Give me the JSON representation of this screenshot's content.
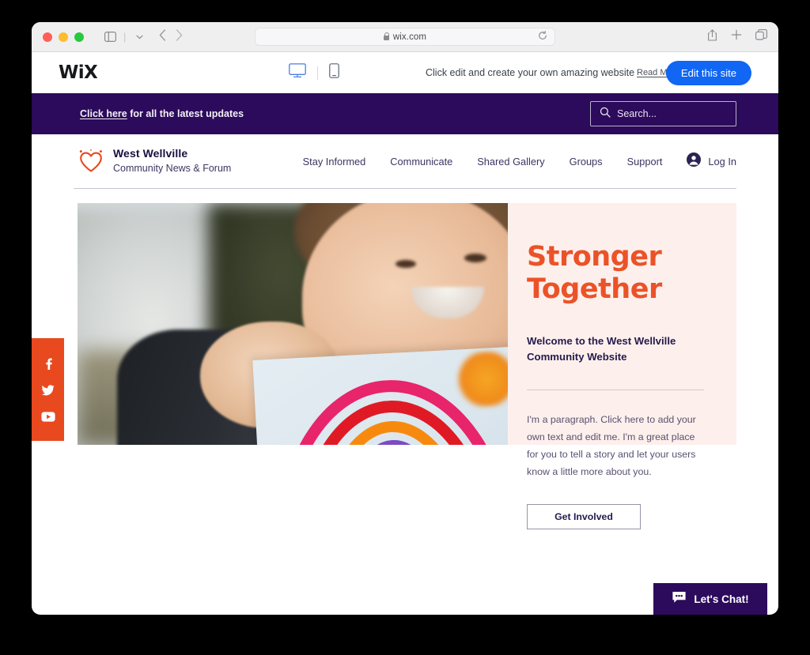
{
  "browser": {
    "traffic_lights": [
      "close",
      "minimize",
      "maximize"
    ],
    "sidebar_toggle_icon": "sidebar-icon",
    "sidebar_dropdown_icon": "chevron-down-icon",
    "back_icon": "chevron-left-icon",
    "forward_icon": "chevron-right-icon",
    "url": "wix.com",
    "lock_icon": "lock-icon",
    "reload_icon": "reload-icon",
    "share_icon": "share-icon",
    "new_tab_icon": "plus-icon",
    "tabs_icon": "tabs-overview-icon"
  },
  "wix_bar": {
    "logo": "WiX",
    "desktop_view_icon": "desktop-monitor-icon",
    "mobile_view_icon": "mobile-phone-icon",
    "message": "Click edit and create your own amazing website",
    "read_more_label": "Read More",
    "edit_button_label": "Edit this site",
    "edit_button_color": "#1166f3"
  },
  "announcement": {
    "link_text": "Click here",
    "rest_text": " for all the latest updates",
    "background_color": "#2c0a5c",
    "search": {
      "placeholder": "Search...",
      "icon": "search-icon"
    }
  },
  "site_header": {
    "logo_icon": "heart-logo-icon",
    "brand_title": "West Wellville",
    "brand_subtitle": "Community News & Forum",
    "nav_items": [
      {
        "label": "Stay Informed"
      },
      {
        "label": "Communicate"
      },
      {
        "label": "Shared Gallery"
      },
      {
        "label": "Groups"
      },
      {
        "label": "Support"
      }
    ],
    "login": {
      "avatar_icon": "account-avatar-icon",
      "label": "Log In"
    }
  },
  "hero": {
    "image_alt": "child holding up rainbow drawing",
    "heading_line1": "Stronger",
    "heading_line2": "Together",
    "heading_color": "#ec5228",
    "subheading": "Welcome to the West Wellville Community Website",
    "paragraph": "I'm a paragraph. Click here to add your own text and edit me. I'm a great place for you to tell a story and let your users know a little more about you.",
    "cta_label": "Get Involved",
    "panel_background": "#fdf0ec"
  },
  "social_rail": {
    "background_color": "#e8491f",
    "items": [
      {
        "icon": "facebook-icon",
        "name": "Facebook"
      },
      {
        "icon": "twitter-icon",
        "name": "Twitter"
      },
      {
        "icon": "youtube-icon",
        "name": "YouTube"
      }
    ]
  },
  "chat_widget": {
    "label": "Let's Chat!",
    "icon": "chat-bubble-icon",
    "background_color": "#2c0a5c"
  }
}
